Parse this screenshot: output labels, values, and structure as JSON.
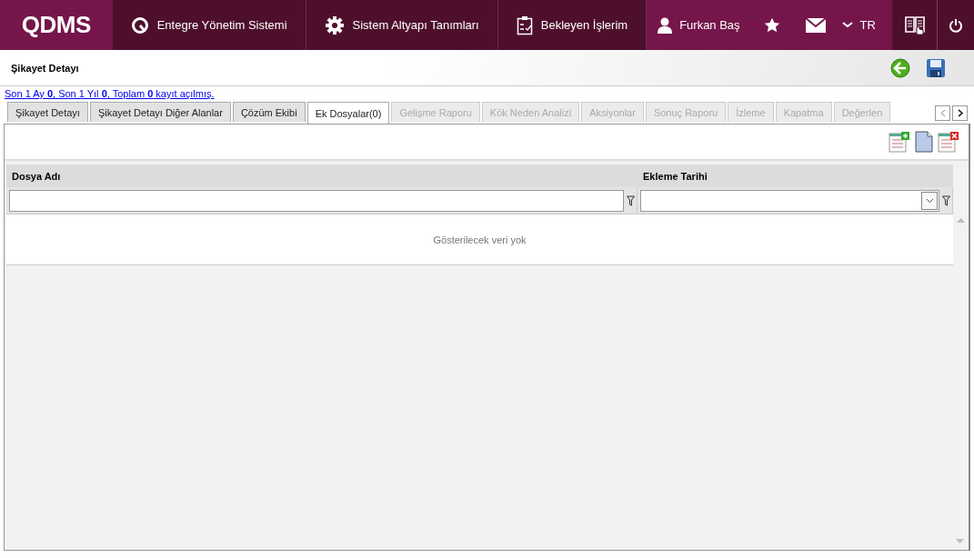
{
  "header": {
    "logo": "QDMS",
    "nav": [
      {
        "label": "Entegre Yönetim Sistemi"
      },
      {
        "label": "Sistem Altyapı Tanımları"
      },
      {
        "label": "Bekleyen İşlerim"
      }
    ],
    "user": "Furkan Baş",
    "language": "TR"
  },
  "page": {
    "title": "Şikayet Detayı",
    "stats": "Son 1 Ay **0**, Son 1 Yıl **0**, Toplam **0** kayıt açılmış."
  },
  "tabs": [
    {
      "label": "Şikayet Detayı",
      "selected": false,
      "disabled": false
    },
    {
      "label": "Şikayet Detayı Diğer Alanlar",
      "selected": false,
      "disabled": false
    },
    {
      "label": "Çözüm Ekibi",
      "selected": false,
      "disabled": false
    },
    {
      "label": "Ek Dosyalar(0)",
      "selected": true,
      "disabled": false
    },
    {
      "label": "Gelişme Raporu",
      "selected": false,
      "disabled": true
    },
    {
      "label": "Kök Neden Analizi",
      "selected": false,
      "disabled": true
    },
    {
      "label": "Aksiyonlar",
      "selected": false,
      "disabled": true
    },
    {
      "label": "Sonuç Raporu",
      "selected": false,
      "disabled": true
    },
    {
      "label": "İzleme",
      "selected": false,
      "disabled": true
    },
    {
      "label": "Kapatma",
      "selected": false,
      "disabled": true
    },
    {
      "label": "Değerlen",
      "selected": false,
      "disabled": true
    }
  ],
  "grid": {
    "columns": [
      {
        "label": "Dosya Adı",
        "kind": "text"
      },
      {
        "label": "Ekleme Tarihi",
        "kind": "date"
      }
    ],
    "empty_message": "Gösterilecek veri yok"
  }
}
